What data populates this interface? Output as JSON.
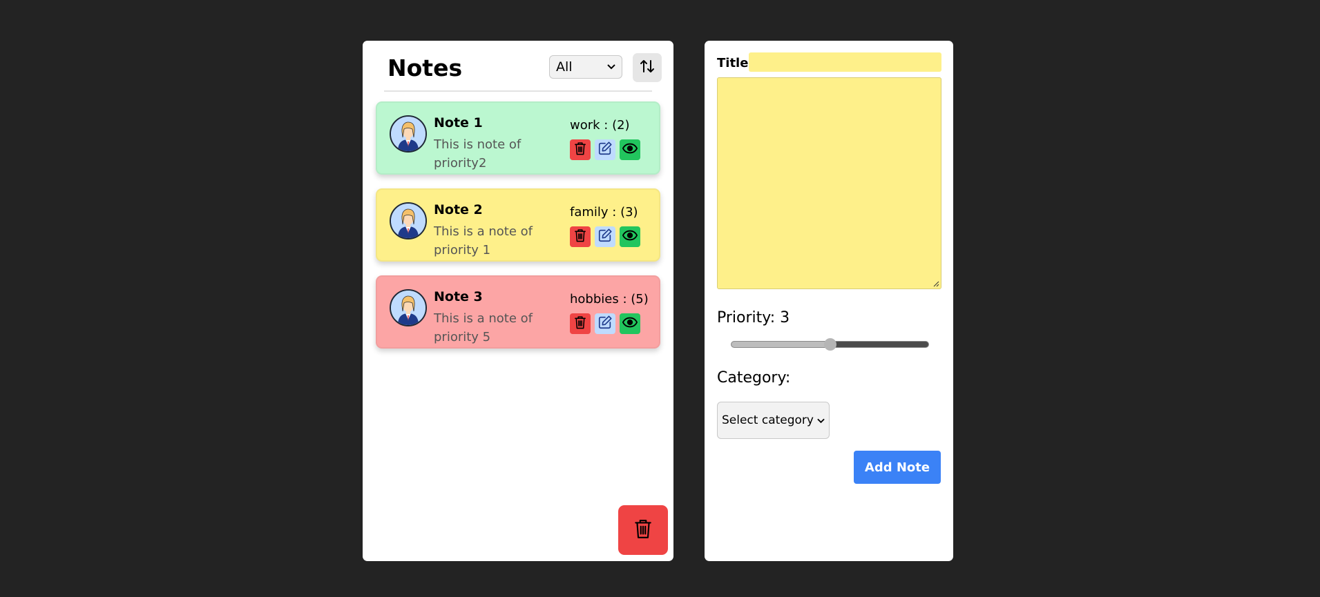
{
  "notes_panel": {
    "title": "Notes",
    "filter": {
      "selected": "All"
    },
    "notes": [
      {
        "title": "Note 1",
        "description": "This is note of priority2",
        "category_text": "work : (2)",
        "color": "#bbf7d0"
      },
      {
        "title": "Note 2",
        "description": "This is a note of priority 1",
        "category_text": "family : (3)",
        "color": "#fef08a"
      },
      {
        "title": "Note 3",
        "description": "This is a note of priority 5",
        "category_text": "hobbies : (5)",
        "color": "#fca5a5"
      }
    ]
  },
  "editor": {
    "title_label": "Title:",
    "title_value": "",
    "body_value": "",
    "priority_label": "Priority: 3",
    "priority_value": 3,
    "priority_min": 1,
    "priority_max": 5,
    "category_label": "Category:",
    "category_selected": "Select category",
    "add_button": "Add Note"
  },
  "colors": {
    "background": "#232323",
    "delete": "#ef4444",
    "edit": "#bfdbfe",
    "view": "#22c55e",
    "primary": "#3b82f6",
    "input_yellow": "#fef08a"
  },
  "icons": {
    "sort": "sort-arrows-icon",
    "delete": "trash-icon",
    "edit": "pencil-square-icon",
    "view": "eye-icon",
    "avatar": "user-avatar-icon"
  }
}
